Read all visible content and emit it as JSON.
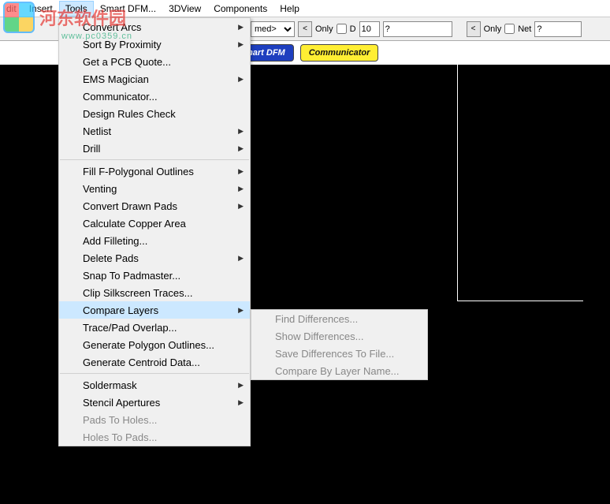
{
  "menubar": {
    "items": [
      "dit",
      "Insert",
      "Tools",
      "Smart DFM...",
      "3DView",
      "Components",
      "Help"
    ],
    "active_index": 2
  },
  "toolbar": {
    "combo": "med>",
    "only_label": "Only",
    "d_label": "D",
    "d_value": "10",
    "q1": "?",
    "net_label": "Net",
    "q2": "?"
  },
  "band": {
    "btn1": "mart DFM",
    "btn2": "Communicator"
  },
  "watermark": {
    "text": "河东软件园",
    "sub": "www.pc0359.cn"
  },
  "tools_menu": [
    {
      "label": "Convert Arcs",
      "arrow": true
    },
    {
      "label": "Sort By Proximity",
      "arrow": true
    },
    {
      "label": "Get a PCB Quote..."
    },
    {
      "label": "EMS Magician",
      "arrow": true
    },
    {
      "label": "Communicator..."
    },
    {
      "label": "Design Rules Check"
    },
    {
      "label": "Netlist",
      "arrow": true
    },
    {
      "label": "Drill",
      "arrow": true
    },
    {
      "sep": true
    },
    {
      "label": "Fill F-Polygonal Outlines",
      "arrow": true
    },
    {
      "label": "Venting",
      "arrow": true
    },
    {
      "label": "Convert Drawn Pads",
      "arrow": true
    },
    {
      "label": "Calculate Copper Area"
    },
    {
      "label": "Add Filleting..."
    },
    {
      "label": "Delete Pads",
      "arrow": true
    },
    {
      "label": "Snap To Padmaster..."
    },
    {
      "label": "Clip Silkscreen Traces..."
    },
    {
      "label": "Compare Layers",
      "arrow": true,
      "highlight": true
    },
    {
      "label": "Trace/Pad Overlap..."
    },
    {
      "label": "Generate Polygon Outlines..."
    },
    {
      "label": "Generate Centroid Data..."
    },
    {
      "sep": true
    },
    {
      "label": "Soldermask",
      "arrow": true
    },
    {
      "label": "Stencil Apertures",
      "arrow": true
    },
    {
      "label": "Pads To Holes...",
      "disabled": true
    },
    {
      "label": "Holes To Pads...",
      "disabled": true
    }
  ],
  "compare_submenu": [
    {
      "label": "Find Differences..."
    },
    {
      "label": "Show Differences..."
    },
    {
      "label": "Save Differences To File..."
    },
    {
      "label": "Compare By Layer Name..."
    }
  ]
}
